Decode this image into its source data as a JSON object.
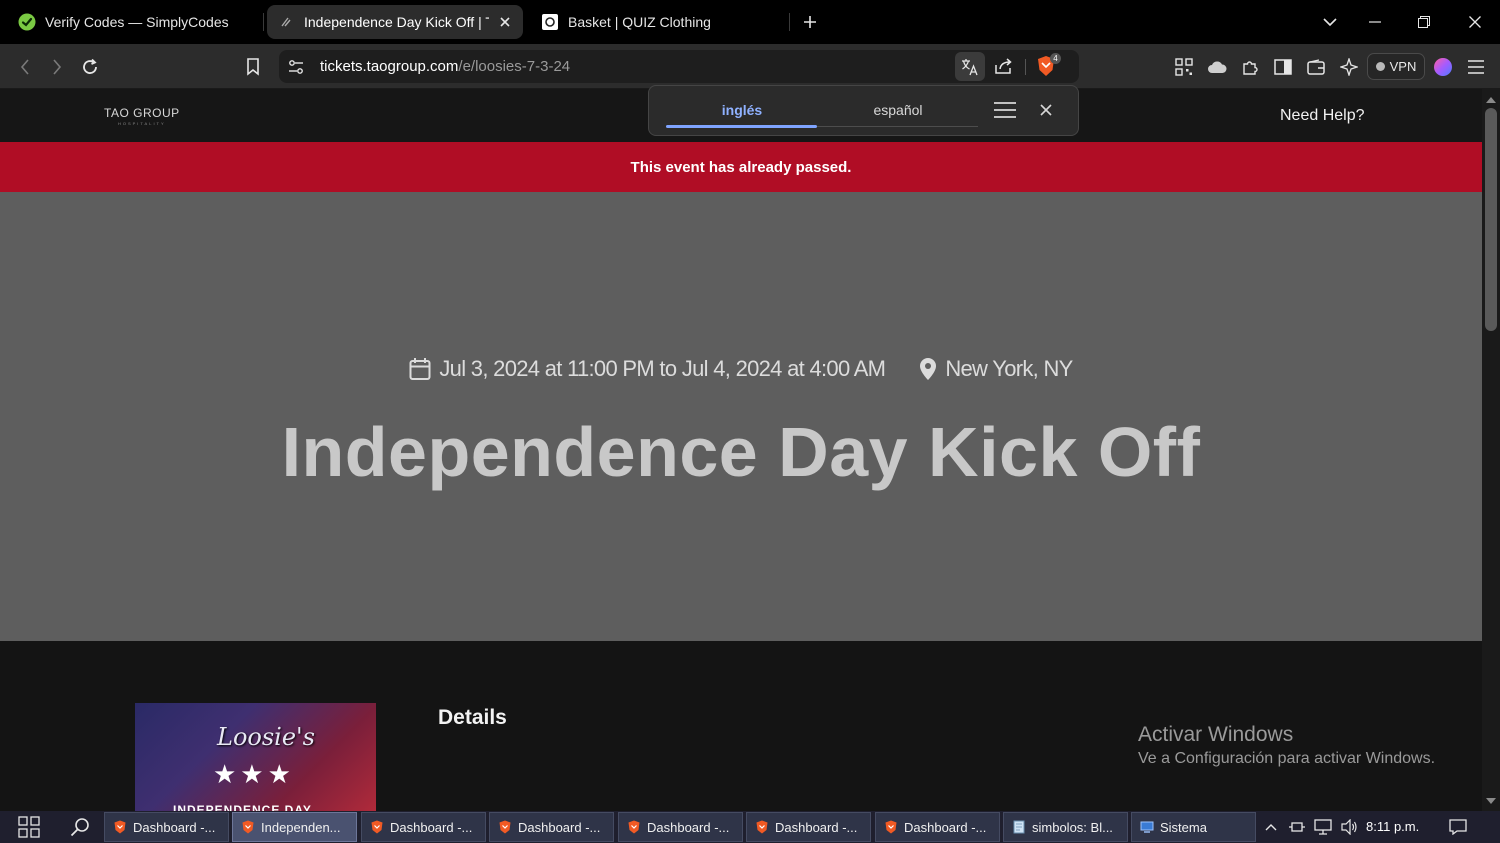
{
  "browser": {
    "tabs": [
      {
        "title": "Verify Codes — SimplyCodes",
        "icon": "simplycodes-favicon",
        "active": false
      },
      {
        "title": "Independence Day Kick Off | Tao",
        "icon": "page-favicon",
        "active": true
      },
      {
        "title": "Basket | QUIZ Clothing",
        "icon": "quiz-favicon",
        "active": false
      }
    ],
    "url_host": "tickets.taogroup.com",
    "url_path": "/e/loosies-7-3-24",
    "vpn_label": "VPN",
    "shields_badge": "4"
  },
  "translate_popup": {
    "languages": [
      "inglés",
      "español"
    ],
    "active_index": 0
  },
  "site": {
    "logo_text": "TAO GROUP",
    "logo_subtext": "HOSPITALITY",
    "need_help": "Need Help?",
    "banner": "This event has already passed.",
    "event": {
      "datetime": "Jul 3, 2024 at 11:00 PM to Jul 4, 2024 at 4:00 AM",
      "location": "New York, NY",
      "title": "Independence Day Kick Off"
    },
    "poster": {
      "script_text": "Loosie's",
      "stars": "★★★",
      "bottom_text": "INDEPENDENCE DAY"
    },
    "details_heading": "Details"
  },
  "watermark": {
    "line1": "Activar Windows",
    "line2": "Ve a Configuración para activar Windows."
  },
  "taskbar": {
    "items": [
      {
        "label": "Dashboard -...",
        "icon": "brave-icon",
        "active": false
      },
      {
        "label": "Independen...",
        "icon": "brave-icon",
        "active": true
      },
      {
        "label": "Dashboard -...",
        "icon": "brave-icon",
        "active": false
      },
      {
        "label": "Dashboard -...",
        "icon": "brave-icon",
        "active": false
      },
      {
        "label": "Dashboard -...",
        "icon": "brave-icon",
        "active": false
      },
      {
        "label": "Dashboard -...",
        "icon": "brave-icon",
        "active": false
      },
      {
        "label": "Dashboard -...",
        "icon": "brave-icon",
        "active": false
      },
      {
        "label": "simbolos: Bl...",
        "icon": "notepad-icon",
        "active": false
      },
      {
        "label": "Sistema",
        "icon": "system-icon",
        "active": false
      }
    ],
    "clock": "8:11 p.m."
  },
  "colors": {
    "banner": "#b00d25",
    "hero_bg": "#5e5e5e",
    "accent_blue": "#7fa4ff"
  }
}
